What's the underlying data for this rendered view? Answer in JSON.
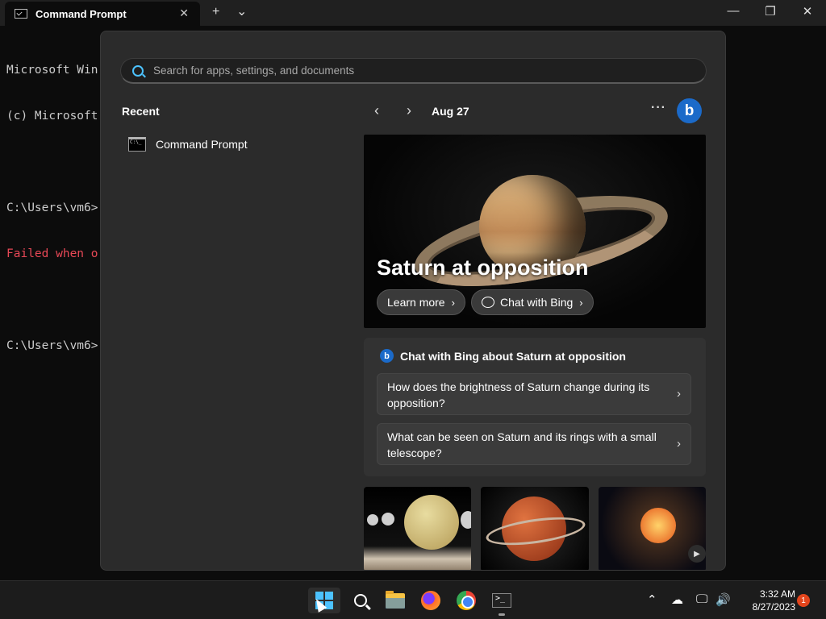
{
  "window": {
    "tab_title": "Command Prompt",
    "new_tab": "+",
    "dropdown": "⌄",
    "close_tab": "✕",
    "minimize": "—",
    "maximize": "❐",
    "close": "✕"
  },
  "terminal": {
    "lines": [
      {
        "text": "Microsoft Win",
        "type": "normal"
      },
      {
        "text": "(c) Microsoft",
        "type": "normal"
      },
      {
        "text": "",
        "type": "normal"
      },
      {
        "text": "C:\\Users\\vm6>",
        "type": "normal"
      },
      {
        "text": "Failed when o",
        "type": "error"
      },
      {
        "text": "",
        "type": "normal"
      },
      {
        "text": "C:\\Users\\vm6>",
        "type": "normal"
      }
    ]
  },
  "start_menu": {
    "search_placeholder": "Search for apps, settings, and documents",
    "recent_title": "Recent",
    "recent_items": [
      {
        "label": "Command Prompt",
        "icon": "cmd-icon"
      }
    ],
    "nav": {
      "prev": "‹",
      "next": "›",
      "date": "Aug 27",
      "more": "···",
      "bing": "b"
    },
    "hero": {
      "title": "Saturn at opposition",
      "learn_more": "Learn more",
      "chat_with_bing": "Chat with Bing",
      "chevron": "›"
    },
    "chat_card": {
      "heading": "Chat with Bing about Saturn at opposition",
      "suggestions": [
        "How does the brightness of Saturn change during its opposition?",
        "What can be seen on Saturn and its rings with a small telescope?"
      ],
      "chevron": "›"
    },
    "thumbnails": [
      "solar-system-planets-image",
      "red-ringed-planet-image",
      "sun-and-planets-image"
    ]
  },
  "taskbar": {
    "icons": [
      "windows-start-icon",
      "search-icon",
      "file-explorer-icon",
      "firefox-icon",
      "chrome-icon",
      "terminal-icon"
    ],
    "tray": {
      "chevron": "⌃",
      "cloud": "☁",
      "network": "🖵",
      "volume": "🔊"
    },
    "time": "3:32 AM",
    "date": "8/27/2023",
    "notifications": "1"
  },
  "colors": {
    "accent": "#4cc2ff",
    "bing_blue": "#1b6ac9",
    "error_red": "#e74856",
    "menu_bg": "#2b2b2b",
    "notif_badge": "#e3451c"
  }
}
